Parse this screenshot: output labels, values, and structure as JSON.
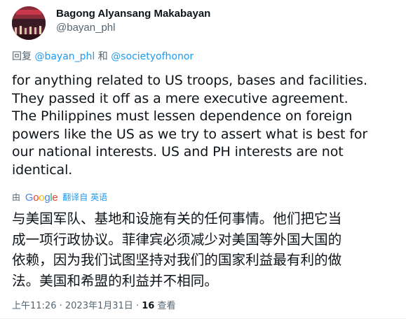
{
  "author": {
    "display_name": "Bagong Alyansang Makabayan",
    "handle": "@bayan_phl"
  },
  "reply_context": {
    "prefix": "回复",
    "mentions": [
      "@bayan_phl",
      "@societyofhonor"
    ],
    "conjunction": "和"
  },
  "tweet_text_lines": [
    "for anything related to US troops, bases and facilities.",
    "They passed it off as a mere executive agreement.",
    "The Philippines must lessen dependence on foreign",
    "powers like the US as we try to assert what is best for",
    "our national interests. US and PH interests are not",
    "identical."
  ],
  "translation": {
    "prefix": "由",
    "provider": "Google",
    "label": "翻译自 英语"
  },
  "translated_lines": [
    "与美国军队、基地和设施有关的任何事情。他们把它当",
    "成一项行政协议。菲律宾必须减少对美国等外国大国的",
    "依赖，因为我们试图坚持对我们的国家利益最有利的做",
    "法。美国和希盟的利益并不相同。"
  ],
  "meta": {
    "time": "上午11:26",
    "date": "2023年1月31日",
    "separator": "·",
    "views_count": "16",
    "views_label": "查看"
  },
  "colors": {
    "text_primary": "#0f1419",
    "text_secondary": "#536471",
    "link": "#1d9bf0",
    "avatar_bg": "#6b2a3a"
  }
}
